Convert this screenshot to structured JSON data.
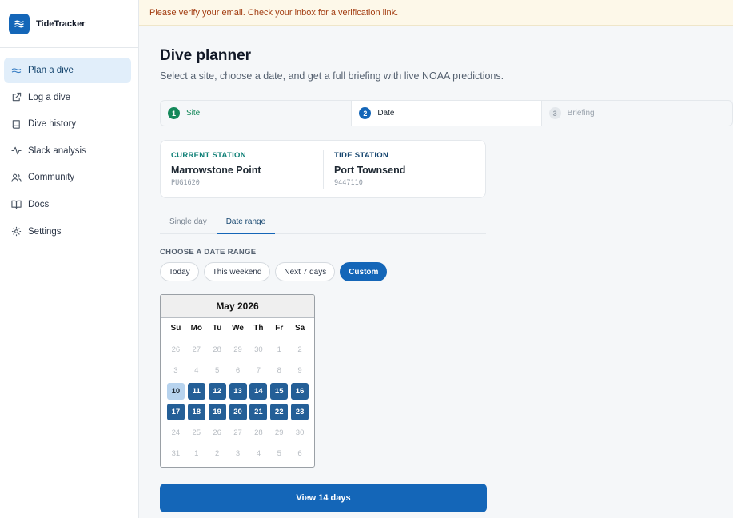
{
  "app": {
    "name": "TideTracker",
    "logo_icon": "waves-icon"
  },
  "sidebar": {
    "items": [
      {
        "label": "Plan a dive",
        "icon": "waves-icon",
        "active": true
      },
      {
        "label": "Log a dive",
        "icon": "external-link-icon",
        "active": false
      },
      {
        "label": "Dive history",
        "icon": "book-icon",
        "active": false
      },
      {
        "label": "Slack analysis",
        "icon": "activity-icon",
        "active": false
      },
      {
        "label": "Community",
        "icon": "users-icon",
        "active": false
      },
      {
        "label": "Docs",
        "icon": "open-book-icon",
        "active": false
      },
      {
        "label": "Settings",
        "icon": "gear-icon",
        "active": false
      }
    ]
  },
  "banner": {
    "text": "Please verify your email. Check your inbox for a verification link."
  },
  "main": {
    "title": "Dive planner",
    "subtitle": "Select a site, choose a date, and get a full briefing with live NOAA predictions.",
    "steps": [
      {
        "num": "1",
        "label": "Site",
        "state": "done"
      },
      {
        "num": "2",
        "label": "Date",
        "state": "current"
      },
      {
        "num": "3",
        "label": "Briefing",
        "state": "future"
      }
    ],
    "stations": {
      "current": {
        "label": "CURRENT STATION",
        "name": "Marrowstone Point",
        "code": "PUG1620"
      },
      "tide": {
        "label": "TIDE STATION",
        "name": "Port Townsend",
        "code": "9447110"
      }
    },
    "modes": [
      {
        "label": "Single day",
        "active": false
      },
      {
        "label": "Date range",
        "active": true
      }
    ],
    "range_label": "CHOOSE A DATE RANGE",
    "chips": [
      {
        "label": "Today",
        "active": false
      },
      {
        "label": "This weekend",
        "active": false
      },
      {
        "label": "Next 7 days",
        "active": false
      },
      {
        "label": "Custom",
        "active": true
      }
    ],
    "calendar": {
      "month": "May 2026",
      "weekdays": [
        "Su",
        "Mo",
        "Tu",
        "We",
        "Th",
        "Fr",
        "Sa"
      ],
      "weeks": [
        [
          {
            "d": "26",
            "s": "other"
          },
          {
            "d": "27",
            "s": "other"
          },
          {
            "d": "28",
            "s": "other"
          },
          {
            "d": "29",
            "s": "other"
          },
          {
            "d": "30",
            "s": "other"
          },
          {
            "d": "1",
            "s": "disabled"
          },
          {
            "d": "2",
            "s": "disabled"
          }
        ],
        [
          {
            "d": "3",
            "s": "disabled"
          },
          {
            "d": "4",
            "s": "disabled"
          },
          {
            "d": "5",
            "s": "disabled"
          },
          {
            "d": "6",
            "s": "disabled"
          },
          {
            "d": "7",
            "s": "disabled"
          },
          {
            "d": "8",
            "s": "disabled"
          },
          {
            "d": "9",
            "s": "disabled"
          }
        ],
        [
          {
            "d": "10",
            "s": "start"
          },
          {
            "d": "11",
            "s": "sel"
          },
          {
            "d": "12",
            "s": "sel"
          },
          {
            "d": "13",
            "s": "sel"
          },
          {
            "d": "14",
            "s": "sel"
          },
          {
            "d": "15",
            "s": "sel"
          },
          {
            "d": "16",
            "s": "sel"
          }
        ],
        [
          {
            "d": "17",
            "s": "sel"
          },
          {
            "d": "18",
            "s": "sel"
          },
          {
            "d": "19",
            "s": "sel"
          },
          {
            "d": "20",
            "s": "sel"
          },
          {
            "d": "21",
            "s": "sel"
          },
          {
            "d": "22",
            "s": "sel"
          },
          {
            "d": "23",
            "s": "sel"
          }
        ],
        [
          {
            "d": "24",
            "s": "disabled"
          },
          {
            "d": "25",
            "s": "disabled"
          },
          {
            "d": "26",
            "s": "disabled"
          },
          {
            "d": "27",
            "s": "disabled"
          },
          {
            "d": "28",
            "s": "disabled"
          },
          {
            "d": "29",
            "s": "disabled"
          },
          {
            "d": "30",
            "s": "disabled"
          }
        ],
        [
          {
            "d": "31",
            "s": "disabled"
          },
          {
            "d": "1",
            "s": "other"
          },
          {
            "d": "2",
            "s": "other"
          },
          {
            "d": "3",
            "s": "other"
          },
          {
            "d": "4",
            "s": "other"
          },
          {
            "d": "5",
            "s": "other"
          },
          {
            "d": "6",
            "s": "other"
          }
        ]
      ]
    },
    "cta_label": "View 14 days"
  },
  "colors": {
    "accent": "#1466b8",
    "success": "#14885a",
    "banner_text": "#a33e13",
    "selected_day": "#245f97",
    "range_start": "#b7d3ee"
  }
}
